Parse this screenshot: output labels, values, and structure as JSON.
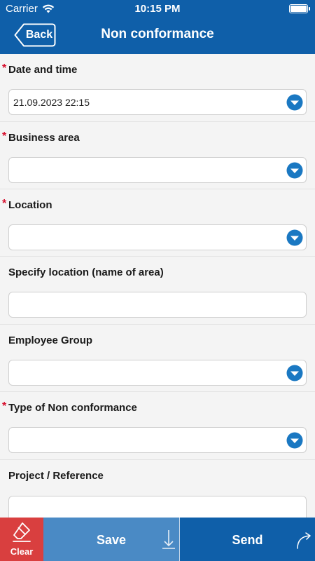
{
  "status_bar": {
    "carrier": "Carrier",
    "time": "10:15 PM"
  },
  "header": {
    "back_label": "Back",
    "title": "Non conformance"
  },
  "fields": [
    {
      "label": "Date and time",
      "required": "*",
      "value": "21.09.2023 22:15",
      "type": "dropdown"
    },
    {
      "label": "Business area",
      "required": "*",
      "value": "",
      "type": "dropdown"
    },
    {
      "label": "Location",
      "required": "*",
      "value": "",
      "type": "dropdown"
    },
    {
      "label": "Specify location (name of area)",
      "required": "",
      "value": "",
      "type": "text"
    },
    {
      "label": "Employee Group",
      "required": "",
      "value": "",
      "type": "dropdown"
    },
    {
      "label": "Type of Non conformance",
      "required": "*",
      "value": "",
      "type": "dropdown"
    },
    {
      "label": "Project / Reference",
      "required": "",
      "value": "",
      "type": "text"
    }
  ],
  "toolbar": {
    "clear_label": "Clear",
    "save_label": "Save",
    "send_label": "Send"
  },
  "colors": {
    "header": "#0f5fa9",
    "required": "#d6102e",
    "clear": "#d93f3f",
    "save": "#4a8ac5",
    "send": "#0f5fa9",
    "dropdown_icon": "#1a78c2"
  }
}
